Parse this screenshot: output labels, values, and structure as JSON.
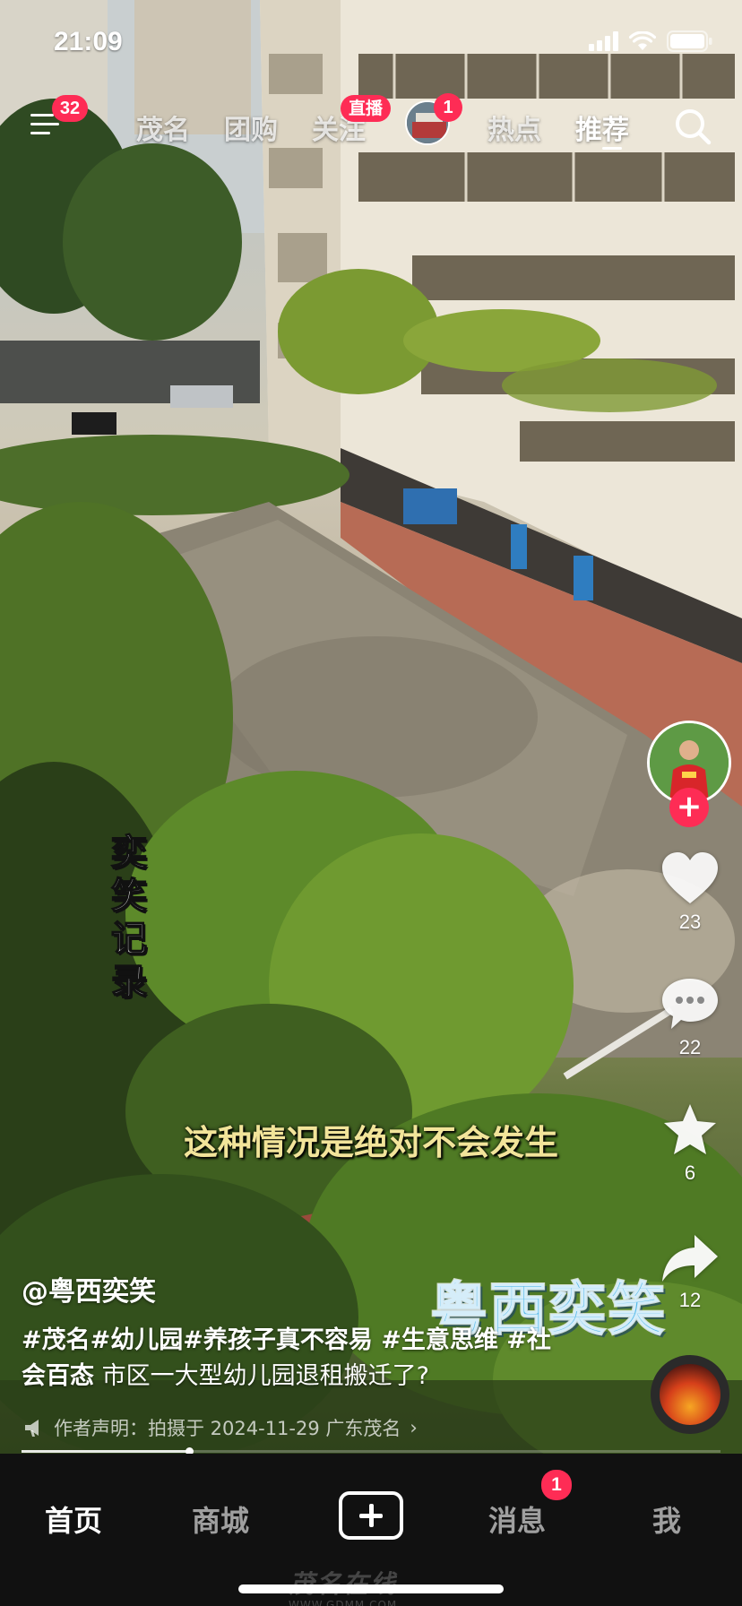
{
  "status_bar": {
    "time": "21:09"
  },
  "top_nav": {
    "menu_badge": "32",
    "tabs": [
      {
        "label": "茂名",
        "active": false
      },
      {
        "label": "团购",
        "active": false
      },
      {
        "label": "关注",
        "active": false
      },
      {
        "label": "热点",
        "active": false
      },
      {
        "label": "推荐",
        "active": true
      }
    ],
    "live_badge": "直播",
    "avatar_badge": "1"
  },
  "video": {
    "vertical_title": "奕笑记录",
    "subtitle": "这种情况是绝对不会发生",
    "watermark": "粤西奕笑"
  },
  "actions": {
    "likes": "23",
    "comments": "22",
    "favorites": "6",
    "shares": "12"
  },
  "caption": {
    "author": "@粤西奕笑",
    "tags": "#茂名#幼儿园#养孩子真不容易 #生意思维 #社会百态",
    "text": "市区一大型幼儿园退租搬迁了?",
    "declaration": "作者声明：拍摄于 2024-11-29 广东茂名",
    "progress": 0.24
  },
  "tab_bar": {
    "tabs": [
      {
        "label": "首页",
        "active": true
      },
      {
        "label": "商城",
        "active": false
      },
      {
        "label": "消息",
        "active": false
      },
      {
        "label": "我",
        "active": false
      }
    ],
    "message_badge": "1"
  },
  "watermark_site": {
    "name": "茂名在线",
    "url": "WWW.GDMM.COM"
  },
  "colors": {
    "accent": "#fe2c55",
    "subtitle": "#f2e49a",
    "watermark": "#57b9e8",
    "tab_bar_bg": "#111111"
  }
}
